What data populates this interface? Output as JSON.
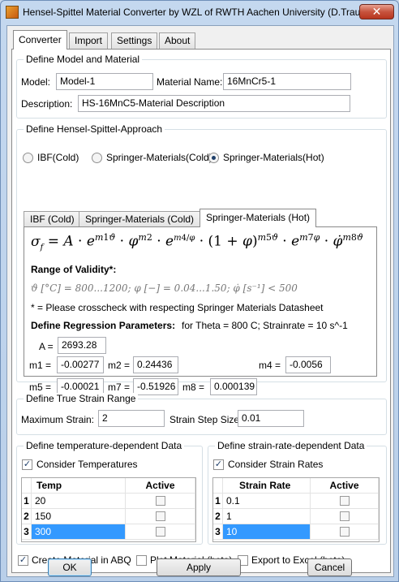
{
  "window": {
    "title": "Hensel-Spittel Material Converter by WZL of RWTH Aachen University (D.Trauth)",
    "close_glyph": "✕"
  },
  "tabs": [
    "Converter",
    "Import",
    "Settings",
    "About"
  ],
  "model": {
    "group_title": "Define Model and Material",
    "model_label": "Model:",
    "model_value": "Model-1",
    "material_label": "Material Name:",
    "material_value": "16MnCr5-1",
    "description_label": "Description:",
    "description_value": "HS-16MnC5-Material Description"
  },
  "approach": {
    "group_title": "Define Hensel-Spittel-Approach",
    "radios": [
      "IBF(Cold)",
      "Springer-Materials(Cold)",
      "Springer-Materials(Hot)"
    ],
    "selected_radio": 2,
    "subtabs": [
      "IBF (Cold)",
      "Springer-Materials (Cold)",
      "Springer-Materials (Hot)"
    ],
    "formula": "σ_f = A · e^{m1ϑ} · φ^{m2} · e^{m4/φ} · (1 + φ)^{m5ϑ} · e^{m7φ} · φ̇^{m8ϑ}",
    "validity_title": "Range of Validity*:",
    "validity_text": "ϑ [°C] = 800...1200;  φ [−] = 0.04...1.50;  φ̇ [s⁻¹] < 500",
    "note": "* = Please crosscheck with respecting Springer Materials Datasheet",
    "regression_title": "Define Regression Parameters:",
    "regression_info": "for Theta = 800 C; Strainrate = 10 s^-1",
    "params": {
      "A_label": "A =",
      "A": "2693.28",
      "m1_label": "m1 =",
      "m1": "-0.00277",
      "m2_label": "m2 =",
      "m2": "0.24436",
      "m4_label": "m4 =",
      "m4": "-0.0056",
      "m5_label": "m5 =",
      "m5": "-0.00021",
      "m7_label": "m7 =",
      "m7": "-0.51926",
      "m8_label": "m8 =",
      "m8": "0.000139"
    }
  },
  "strain_range": {
    "group_title": "Define True Strain Range",
    "max_label": "Maximum Strain:",
    "max_value": "2",
    "step_label": "Strain Step Size:",
    "step_value": "0.01"
  },
  "temperature": {
    "group_title": "Define temperature-dependent Data",
    "consider_label": "Consider Temperatures",
    "consider_checked": true,
    "headers": [
      "Temp",
      "Active"
    ],
    "rows": [
      {
        "num": "1",
        "value": "20"
      },
      {
        "num": "2",
        "value": "150"
      },
      {
        "num": "3",
        "value": "300"
      }
    ]
  },
  "strain_rate": {
    "group_title": "Define strain-rate-dependent Data",
    "consider_label": "Consider Strain Rates",
    "consider_checked": true,
    "headers": [
      "Strain Rate",
      "Active"
    ],
    "rows": [
      {
        "num": "1",
        "value": "0.1"
      },
      {
        "num": "2",
        "value": "1"
      },
      {
        "num": "3",
        "value": "10"
      }
    ]
  },
  "options": {
    "create_abq": "Create Material in ABQ",
    "plot": "Plot Material (beta)",
    "export": "Export to Excel (beta)"
  },
  "buttons": {
    "ok": "OK",
    "apply": "Apply",
    "cancel": "Cancel"
  }
}
